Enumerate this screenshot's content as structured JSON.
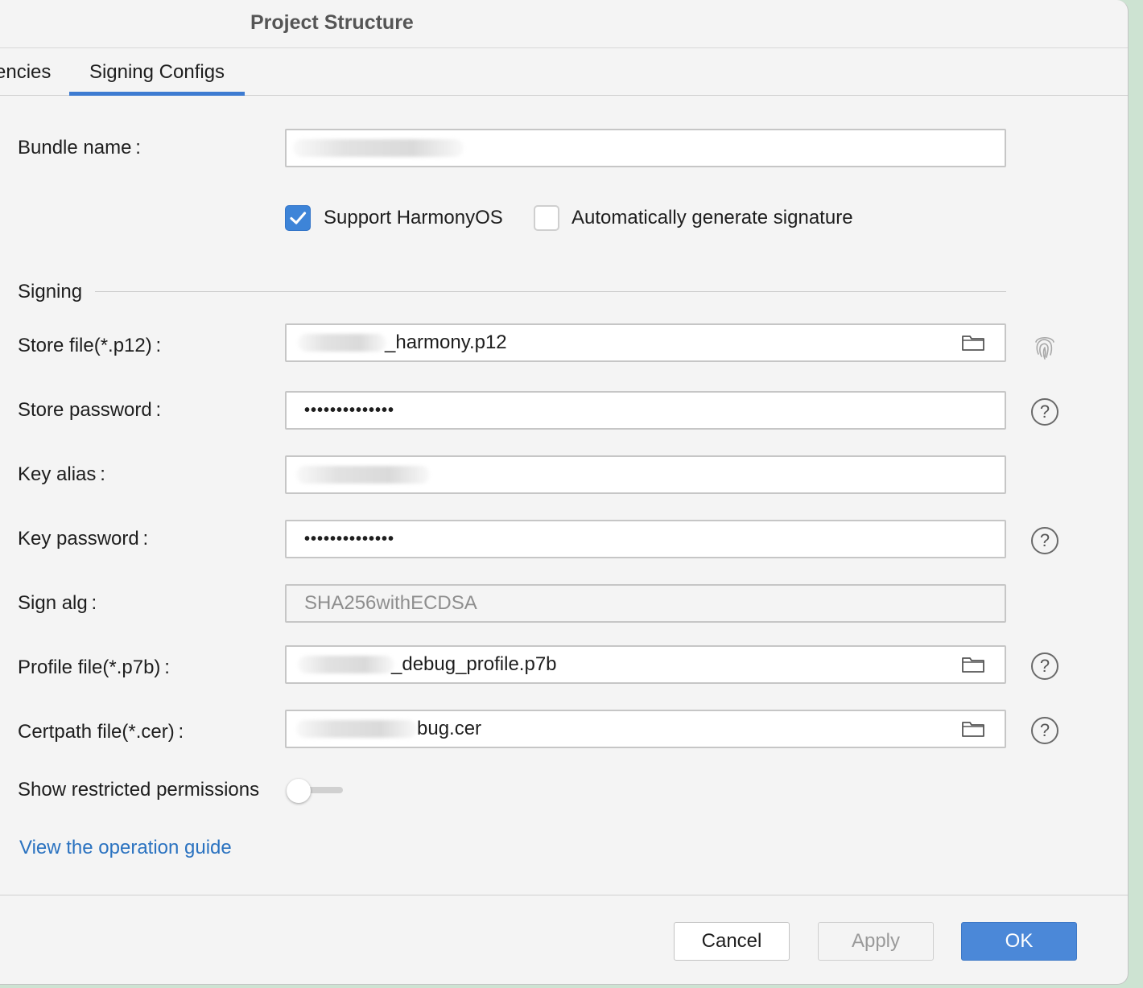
{
  "window": {
    "title": "Project Structure"
  },
  "tabs": [
    {
      "label": "encies",
      "active": false
    },
    {
      "label": "Signing Configs",
      "active": true
    }
  ],
  "form": {
    "bundle_name": {
      "label": "Bundle name :",
      "value": ""
    },
    "support_harmonyos": {
      "label": "Support HarmonyOS",
      "checked": true
    },
    "auto_signature": {
      "label": "Automatically generate signature",
      "checked": false
    },
    "section_signing": "Signing",
    "store_file": {
      "label": "Store file(*.p12) :",
      "value": "_harmony.p12"
    },
    "store_password": {
      "label": "Store password :",
      "value": "••••••••••••••"
    },
    "key_alias": {
      "label": "Key alias :",
      "value": ""
    },
    "key_password": {
      "label": "Key password :",
      "value": "••••••••••••••"
    },
    "sign_alg": {
      "label": "Sign alg :",
      "value": "SHA256withECDSA"
    },
    "profile_file": {
      "label": "Profile file(*.p7b) :",
      "value": "_debug_profile.p7b"
    },
    "certpath_file": {
      "label": "Certpath file(*.cer) :",
      "value": "bug.cer"
    },
    "show_restricted": {
      "label": "Show restricted permissions",
      "on": false
    },
    "help_glyph": "?",
    "operation_guide_link": "View the operation guide"
  },
  "buttons": {
    "cancel": "Cancel",
    "apply": "Apply",
    "ok": "OK"
  },
  "colors": {
    "accent": "#3d84d8",
    "link": "#2a72c0",
    "ok_button": "#4b88d8"
  },
  "icons": {
    "folder": "folder-icon",
    "fingerprint": "fingerprint-icon",
    "help": "help-icon",
    "check": "check-icon"
  }
}
